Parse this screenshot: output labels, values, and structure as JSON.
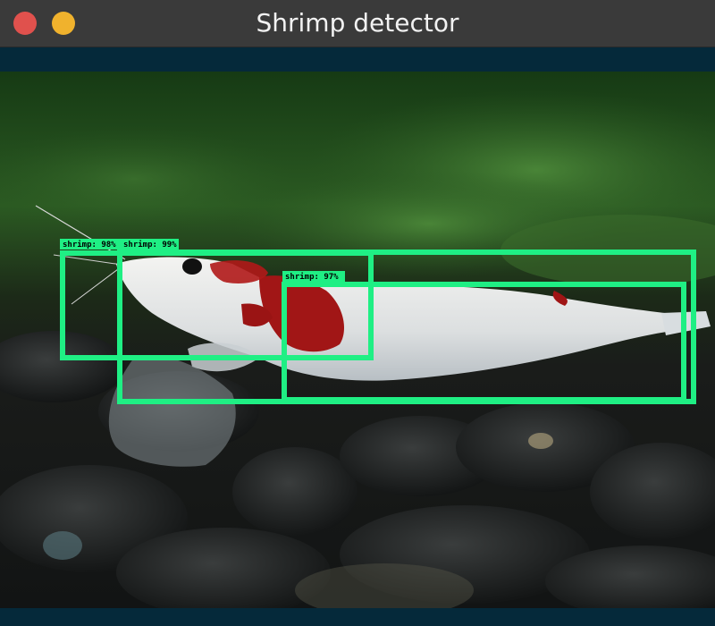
{
  "window": {
    "title": "Shrimp detector",
    "close_color": "#e0514d",
    "minimize_color": "#f0b22d"
  },
  "detections": {
    "color": "#1fef84",
    "items": [
      {
        "label": "shrimp: 98%"
      },
      {
        "label": "shrimp: 99%"
      },
      {
        "label": "shrimp: 97%"
      }
    ]
  }
}
